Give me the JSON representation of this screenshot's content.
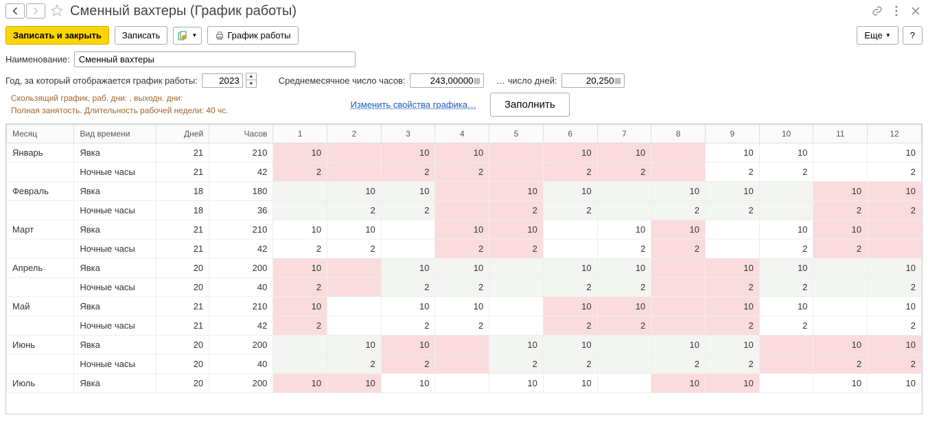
{
  "title": "Сменный вахтеры (График работы)",
  "toolbar": {
    "save_close": "Записать и закрыть",
    "save": "Записать",
    "print": "График работы",
    "more": "Еще",
    "help": "?"
  },
  "form": {
    "name_label": "Наименование:",
    "name_value": "Сменный вахтеры",
    "year_label": "Год, за который отображается график работы:",
    "year_value": "2023",
    "avg_hours_label": "Среднемесячное число часов:",
    "avg_hours_value": "243,00000",
    "avg_days_label": "… число дней:",
    "avg_days_value": "20,250"
  },
  "summary": {
    "line1": "Скользящий график, раб. дни: , выходн. дни:",
    "line2": "Полная занятость. Длительность рабочей недели: 40 чс.",
    "change_link": "Изменить свойства графика…",
    "fill_button": "Заполнить"
  },
  "grid": {
    "headers": {
      "month": "Месяц",
      "time_type": "Вид времени",
      "days": "Дней",
      "hours": "Часов"
    },
    "day_cols": [
      "1",
      "2",
      "3",
      "4",
      "5",
      "6",
      "7",
      "8",
      "9",
      "10",
      "11",
      "12"
    ],
    "rows": [
      {
        "month": "Январь",
        "type": "Явка",
        "days": "21",
        "hours": "210",
        "cells": [
          {
            "v": "10",
            "k": "p"
          },
          {
            "v": "",
            "k": "p"
          },
          {
            "v": "10",
            "k": "p"
          },
          {
            "v": "10",
            "k": "p"
          },
          {
            "v": "",
            "k": "p"
          },
          {
            "v": "10",
            "k": "p"
          },
          {
            "v": "10",
            "k": "p"
          },
          {
            "v": "",
            "k": "p"
          },
          {
            "v": "10",
            "k": ""
          },
          {
            "v": "10",
            "k": ""
          },
          {
            "v": "",
            "k": ""
          },
          {
            "v": "10",
            "k": ""
          }
        ]
      },
      {
        "month": "",
        "type": "Ночные часы",
        "days": "21",
        "hours": "42",
        "cells": [
          {
            "v": "2",
            "k": "p"
          },
          {
            "v": "",
            "k": "p"
          },
          {
            "v": "2",
            "k": "p"
          },
          {
            "v": "2",
            "k": "p"
          },
          {
            "v": "",
            "k": "p"
          },
          {
            "v": "2",
            "k": "p"
          },
          {
            "v": "2",
            "k": "p"
          },
          {
            "v": "",
            "k": "p"
          },
          {
            "v": "2",
            "k": ""
          },
          {
            "v": "2",
            "k": ""
          },
          {
            "v": "",
            "k": ""
          },
          {
            "v": "2",
            "k": ""
          }
        ]
      },
      {
        "month": "Февраль",
        "type": "Явка",
        "days": "18",
        "hours": "180",
        "cells": [
          {
            "v": "",
            "k": "g"
          },
          {
            "v": "10",
            "k": "g"
          },
          {
            "v": "10",
            "k": "g"
          },
          {
            "v": "",
            "k": "p"
          },
          {
            "v": "10",
            "k": "p"
          },
          {
            "v": "10",
            "k": "g"
          },
          {
            "v": "",
            "k": "g"
          },
          {
            "v": "10",
            "k": "g"
          },
          {
            "v": "10",
            "k": "g"
          },
          {
            "v": "",
            "k": "g"
          },
          {
            "v": "10",
            "k": "p"
          },
          {
            "v": "10",
            "k": "p"
          }
        ]
      },
      {
        "month": "",
        "type": "Ночные часы",
        "days": "18",
        "hours": "36",
        "cells": [
          {
            "v": "",
            "k": "g"
          },
          {
            "v": "2",
            "k": "g"
          },
          {
            "v": "2",
            "k": "g"
          },
          {
            "v": "",
            "k": "p"
          },
          {
            "v": "2",
            "k": "p"
          },
          {
            "v": "2",
            "k": "g"
          },
          {
            "v": "",
            "k": "g"
          },
          {
            "v": "2",
            "k": "g"
          },
          {
            "v": "2",
            "k": "g"
          },
          {
            "v": "",
            "k": "g"
          },
          {
            "v": "2",
            "k": "p"
          },
          {
            "v": "2",
            "k": "p"
          }
        ]
      },
      {
        "month": "Март",
        "type": "Явка",
        "days": "21",
        "hours": "210",
        "cells": [
          {
            "v": "10",
            "k": ""
          },
          {
            "v": "10",
            "k": ""
          },
          {
            "v": "",
            "k": ""
          },
          {
            "v": "10",
            "k": "p"
          },
          {
            "v": "10",
            "k": "p"
          },
          {
            "v": "",
            "k": ""
          },
          {
            "v": "10",
            "k": ""
          },
          {
            "v": "10",
            "k": "p"
          },
          {
            "v": "",
            "k": ""
          },
          {
            "v": "10",
            "k": ""
          },
          {
            "v": "10",
            "k": "p"
          },
          {
            "v": "",
            "k": "p"
          }
        ]
      },
      {
        "month": "",
        "type": "Ночные часы",
        "days": "21",
        "hours": "42",
        "cells": [
          {
            "v": "2",
            "k": ""
          },
          {
            "v": "2",
            "k": ""
          },
          {
            "v": "",
            "k": ""
          },
          {
            "v": "2",
            "k": "p"
          },
          {
            "v": "2",
            "k": "p"
          },
          {
            "v": "",
            "k": ""
          },
          {
            "v": "2",
            "k": ""
          },
          {
            "v": "2",
            "k": "p"
          },
          {
            "v": "",
            "k": ""
          },
          {
            "v": "2",
            "k": ""
          },
          {
            "v": "2",
            "k": "p"
          },
          {
            "v": "",
            "k": "p"
          }
        ]
      },
      {
        "month": "Апрель",
        "type": "Явка",
        "days": "20",
        "hours": "200",
        "cells": [
          {
            "v": "10",
            "k": "p"
          },
          {
            "v": "",
            "k": "p"
          },
          {
            "v": "10",
            "k": "g"
          },
          {
            "v": "10",
            "k": "g"
          },
          {
            "v": "",
            "k": "g"
          },
          {
            "v": "10",
            "k": "g"
          },
          {
            "v": "10",
            "k": "g"
          },
          {
            "v": "",
            "k": "p"
          },
          {
            "v": "10",
            "k": "p"
          },
          {
            "v": "10",
            "k": "g"
          },
          {
            "v": "",
            "k": "g"
          },
          {
            "v": "10",
            "k": "g"
          }
        ]
      },
      {
        "month": "",
        "type": "Ночные часы",
        "days": "20",
        "hours": "40",
        "cells": [
          {
            "v": "2",
            "k": "p"
          },
          {
            "v": "",
            "k": "p"
          },
          {
            "v": "2",
            "k": "g"
          },
          {
            "v": "2",
            "k": "g"
          },
          {
            "v": "",
            "k": "g"
          },
          {
            "v": "2",
            "k": "g"
          },
          {
            "v": "2",
            "k": "g"
          },
          {
            "v": "",
            "k": "p"
          },
          {
            "v": "2",
            "k": "p"
          },
          {
            "v": "2",
            "k": "g"
          },
          {
            "v": "",
            "k": "g"
          },
          {
            "v": "2",
            "k": "g"
          }
        ]
      },
      {
        "month": "Май",
        "type": "Явка",
        "days": "21",
        "hours": "210",
        "cells": [
          {
            "v": "10",
            "k": "p"
          },
          {
            "v": "",
            "k": ""
          },
          {
            "v": "10",
            "k": ""
          },
          {
            "v": "10",
            "k": ""
          },
          {
            "v": "",
            "k": ""
          },
          {
            "v": "10",
            "k": "p"
          },
          {
            "v": "10",
            "k": "p"
          },
          {
            "v": "",
            "k": "p"
          },
          {
            "v": "10",
            "k": "p"
          },
          {
            "v": "10",
            "k": ""
          },
          {
            "v": "",
            "k": ""
          },
          {
            "v": "10",
            "k": ""
          }
        ]
      },
      {
        "month": "",
        "type": "Ночные часы",
        "days": "21",
        "hours": "42",
        "cells": [
          {
            "v": "2",
            "k": "p"
          },
          {
            "v": "",
            "k": ""
          },
          {
            "v": "2",
            "k": ""
          },
          {
            "v": "2",
            "k": ""
          },
          {
            "v": "",
            "k": ""
          },
          {
            "v": "2",
            "k": "p"
          },
          {
            "v": "2",
            "k": "p"
          },
          {
            "v": "",
            "k": "p"
          },
          {
            "v": "2",
            "k": "p"
          },
          {
            "v": "2",
            "k": ""
          },
          {
            "v": "",
            "k": ""
          },
          {
            "v": "2",
            "k": ""
          }
        ]
      },
      {
        "month": "Июнь",
        "type": "Явка",
        "days": "20",
        "hours": "200",
        "cells": [
          {
            "v": "",
            "k": "g"
          },
          {
            "v": "10",
            "k": "g"
          },
          {
            "v": "10",
            "k": "p"
          },
          {
            "v": "",
            "k": "p"
          },
          {
            "v": "10",
            "k": "g"
          },
          {
            "v": "10",
            "k": "g"
          },
          {
            "v": "",
            "k": "g"
          },
          {
            "v": "10",
            "k": "g"
          },
          {
            "v": "10",
            "k": "g"
          },
          {
            "v": "",
            "k": "p"
          },
          {
            "v": "10",
            "k": "p"
          },
          {
            "v": "10",
            "k": "p"
          }
        ]
      },
      {
        "month": "",
        "type": "Ночные часы",
        "days": "20",
        "hours": "40",
        "cells": [
          {
            "v": "",
            "k": "g"
          },
          {
            "v": "2",
            "k": "g"
          },
          {
            "v": "2",
            "k": "p"
          },
          {
            "v": "",
            "k": "p"
          },
          {
            "v": "2",
            "k": "g"
          },
          {
            "v": "2",
            "k": "g"
          },
          {
            "v": "",
            "k": "g"
          },
          {
            "v": "2",
            "k": "g"
          },
          {
            "v": "2",
            "k": "g"
          },
          {
            "v": "",
            "k": "p"
          },
          {
            "v": "2",
            "k": "p"
          },
          {
            "v": "2",
            "k": "p"
          }
        ]
      },
      {
        "month": "Июль",
        "type": "Явка",
        "days": "20",
        "hours": "200",
        "cells": [
          {
            "v": "10",
            "k": "p"
          },
          {
            "v": "10",
            "k": "p"
          },
          {
            "v": "10",
            "k": ""
          },
          {
            "v": "",
            "k": ""
          },
          {
            "v": "10",
            "k": ""
          },
          {
            "v": "10",
            "k": ""
          },
          {
            "v": "",
            "k": ""
          },
          {
            "v": "10",
            "k": "p"
          },
          {
            "v": "10",
            "k": "p"
          },
          {
            "v": "",
            "k": ""
          },
          {
            "v": "10",
            "k": ""
          },
          {
            "v": "10",
            "k": ""
          }
        ]
      }
    ]
  }
}
